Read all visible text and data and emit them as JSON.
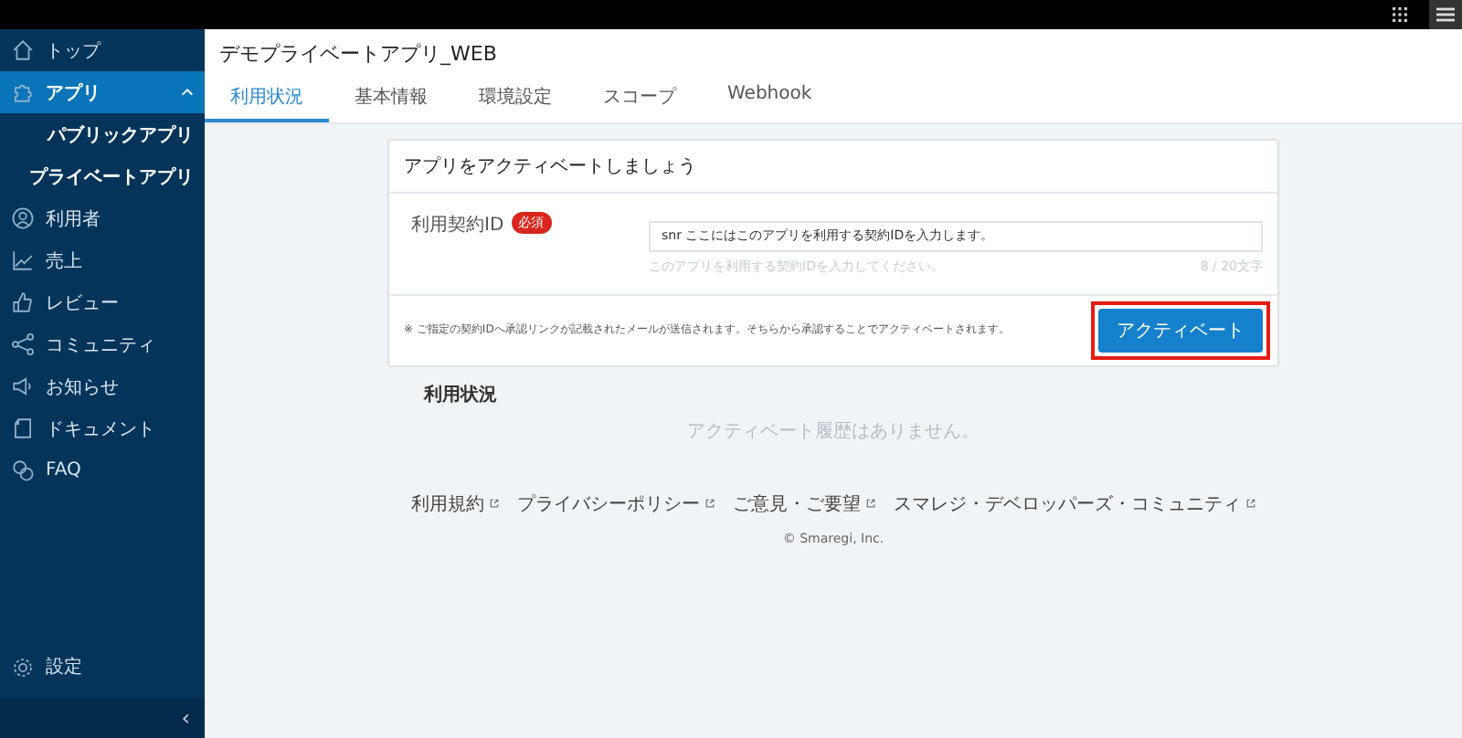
{
  "sidebar": {
    "items": [
      {
        "label": "トップ",
        "selected": false
      },
      {
        "label": "アプリ",
        "selected": true,
        "expanded": true,
        "children": [
          {
            "label": "パブリックアプリ"
          },
          {
            "label": "プライベートアプリ"
          }
        ]
      },
      {
        "label": "利用者",
        "selected": false
      },
      {
        "label": "売上",
        "selected": false
      },
      {
        "label": "レビュー",
        "selected": false
      },
      {
        "label": "コミュニティ",
        "selected": false
      },
      {
        "label": "お知らせ",
        "selected": false
      },
      {
        "label": "ドキュメント",
        "selected": false
      },
      {
        "label": "FAQ",
        "selected": false
      }
    ],
    "settings": "設定",
    "collapse": "‹"
  },
  "page": {
    "title": "デモプライベートアプリ_WEB",
    "tabs": [
      {
        "label": "利用状況",
        "selected": true
      },
      {
        "label": "基本情報",
        "selected": false
      },
      {
        "label": "環境設定",
        "selected": false
      },
      {
        "label": "スコープ",
        "selected": false
      },
      {
        "label": "Webhook",
        "selected": false
      }
    ]
  },
  "card": {
    "title": "アプリをアクティベートしましょう",
    "field_label": "利用契約ID",
    "required_badge": "必須",
    "value": "snr ここにはこのアプリを利用する契約IDを入力します。",
    "hint": "このアプリを利用する契約IDを入力してください。",
    "counter": "8 / 20文字",
    "note": "※ ご指定の契約IDへ承認リンクが記載されたメールが送信されます。そちらから承認することでアクティベートされます。",
    "button": "アクティベート",
    "highlighted": true
  },
  "usage": {
    "heading": "利用状況",
    "empty": "アクティベート履歴はありません。"
  },
  "footer": {
    "links": [
      "利用規約",
      "プライバシーポリシー",
      "ご意見・ご要望",
      "スマレジ・デベロッパーズ・コミュニティ"
    ],
    "copyright": "© Smaregi, Inc."
  }
}
